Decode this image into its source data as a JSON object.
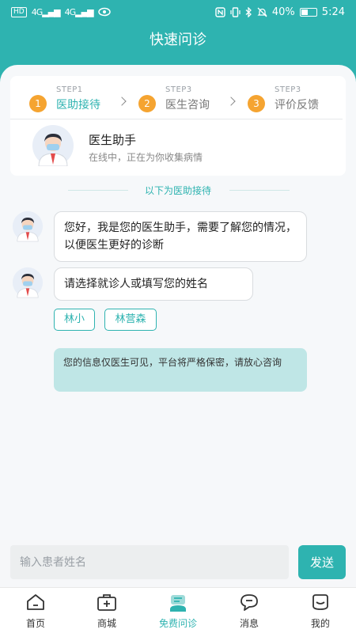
{
  "status_bar": {
    "left_icons": [
      "HD",
      "4G",
      "4G"
    ],
    "battery": "40%",
    "time": "5:24"
  },
  "header": {
    "title": "快速问诊"
  },
  "steps": [
    {
      "num": "1",
      "small": "STEP1",
      "label": "医助接待",
      "active": true
    },
    {
      "num": "2",
      "small": "STEP3",
      "label": "医生咨询",
      "active": false
    },
    {
      "num": "3",
      "small": "STEP3",
      "label": "评价反馈",
      "active": false
    }
  ],
  "assistant": {
    "name": "医生助手",
    "status": "在线中，正在为你收集病情"
  },
  "separator": {
    "text": "以下为医助接待"
  },
  "chat": {
    "messages": [
      {
        "text": "您好，我是您的医生助手，需要了解您的情况，以便医生更好的诊断"
      },
      {
        "text": "请选择就诊人或填写您的姓名"
      }
    ],
    "options": [
      "林小",
      "林营森"
    ],
    "notice": "您的信息仅医生可见，平台将严格保密，请放心咨询"
  },
  "input": {
    "placeholder": "输入患者姓名",
    "value": ""
  },
  "send_label": "发送",
  "tabs": [
    {
      "label": "首页",
      "icon": "home-icon",
      "active": false
    },
    {
      "label": "商城",
      "icon": "medkit-icon",
      "active": false
    },
    {
      "label": "免费问诊",
      "icon": "consult-icon",
      "active": true
    },
    {
      "label": "消息",
      "icon": "message-icon",
      "active": false
    },
    {
      "label": "我的",
      "icon": "profile-icon",
      "active": false
    }
  ],
  "colors": {
    "accent": "#2eb3b0",
    "step_badge": "#f5a431",
    "notice_bg": "#bfe6e6"
  }
}
